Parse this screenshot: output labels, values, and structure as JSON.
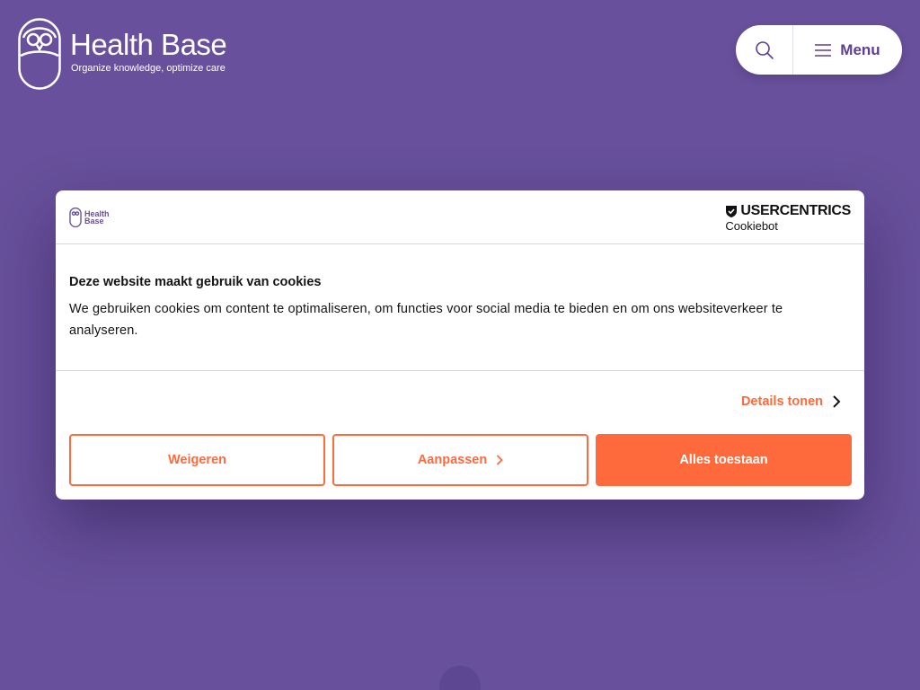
{
  "brand": {
    "name": "Health Base",
    "tagline": "Organize knowledge, optimize care"
  },
  "nav": {
    "search_icon": "search-icon",
    "menu_icon": "hamburger-icon",
    "menu_label": "Menu"
  },
  "cookie_dialog": {
    "mini_logo_line1": "Health",
    "mini_logo_line2": "Base",
    "provider_top": "USERCENTRICS",
    "provider_bottom": "Cookiebot",
    "title": "Deze website maakt gebruik van cookies",
    "description": "We gebruiken cookies om content te optimaliseren, om functies voor social media te bieden en om ons websiteverkeer te analyseren.",
    "details_label": "Details tonen",
    "buttons": {
      "deny": "Weigeren",
      "customize": "Aanpassen",
      "allow_all": "Alles toestaan"
    }
  },
  "colors": {
    "background": "#68509c",
    "accent": "#ff6a3d",
    "brand_purple": "#5b3f95"
  }
}
